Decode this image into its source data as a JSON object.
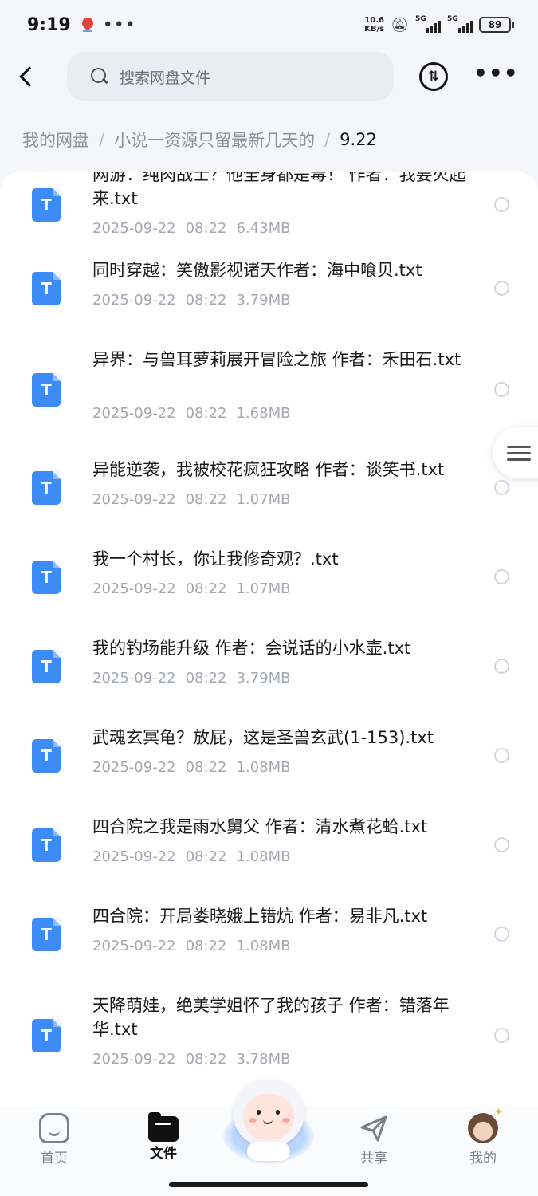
{
  "status_bar": {
    "time": "9:19",
    "dots": "•••",
    "net_speed_value": "10.6",
    "net_speed_unit": "KB/s",
    "sim1": "5G",
    "sim2": "5G",
    "battery": "89"
  },
  "header": {
    "search_placeholder": "搜索网盘文件",
    "transfer_glyph": "⇅"
  },
  "breadcrumb": {
    "items": [
      "我的网盘",
      "小说一资源只留最新几天的",
      "9.22"
    ],
    "separator": "/"
  },
  "files": [
    {
      "name": "网游：纯肉战士？他全身都是毒！ 作者：我要火起来.txt",
      "date": "2025-09-22",
      "time": "08:22",
      "size": "6.43MB"
    },
    {
      "name": "同时穿越：笑傲影视诸天作者：海中喰贝.txt",
      "date": "2025-09-22",
      "time": "08:22",
      "size": "3.79MB"
    },
    {
      "name": "异界：与兽耳萝莉展开冒险之旅 作者：禾田石.txt",
      "date": "2025-09-22",
      "time": "08:22",
      "size": "1.68MB"
    },
    {
      "name": "异能逆袭，我被校花疯狂攻略 作者：谈笑书.txt",
      "date": "2025-09-22",
      "time": "08:22",
      "size": "1.07MB"
    },
    {
      "name": "我一个村长，你让我修奇观？.txt",
      "date": "2025-09-22",
      "time": "08:22",
      "size": "1.07MB"
    },
    {
      "name": "我的钓场能升级 作者：会说话的小水壶.txt",
      "date": "2025-09-22",
      "time": "08:22",
      "size": "3.79MB"
    },
    {
      "name": "武魂玄冥龟？放屁，这是圣兽玄武(1-153).txt",
      "date": "2025-09-22",
      "time": "08:22",
      "size": "1.08MB"
    },
    {
      "name": "四合院之我是雨水舅父 作者：清水煮花蛤.txt",
      "date": "2025-09-22",
      "time": "08:22",
      "size": "1.08MB"
    },
    {
      "name": "四合院：开局娄晓娥上错炕 作者：易非凡.txt",
      "date": "2025-09-22",
      "time": "08:22",
      "size": "1.08MB"
    },
    {
      "name": "天降萌娃，绝美学姐怀了我的孩子 作者：错落年华.txt",
      "date": "2025-09-22",
      "time": "08:22",
      "size": "3.78MB"
    }
  ],
  "file_icon_letter": "T",
  "bottom_nav": {
    "home": "首页",
    "files": "文件",
    "share": "共享",
    "me": "我的"
  },
  "colors": {
    "accent": "#3d8bf7",
    "background": "#f4f6fb"
  }
}
